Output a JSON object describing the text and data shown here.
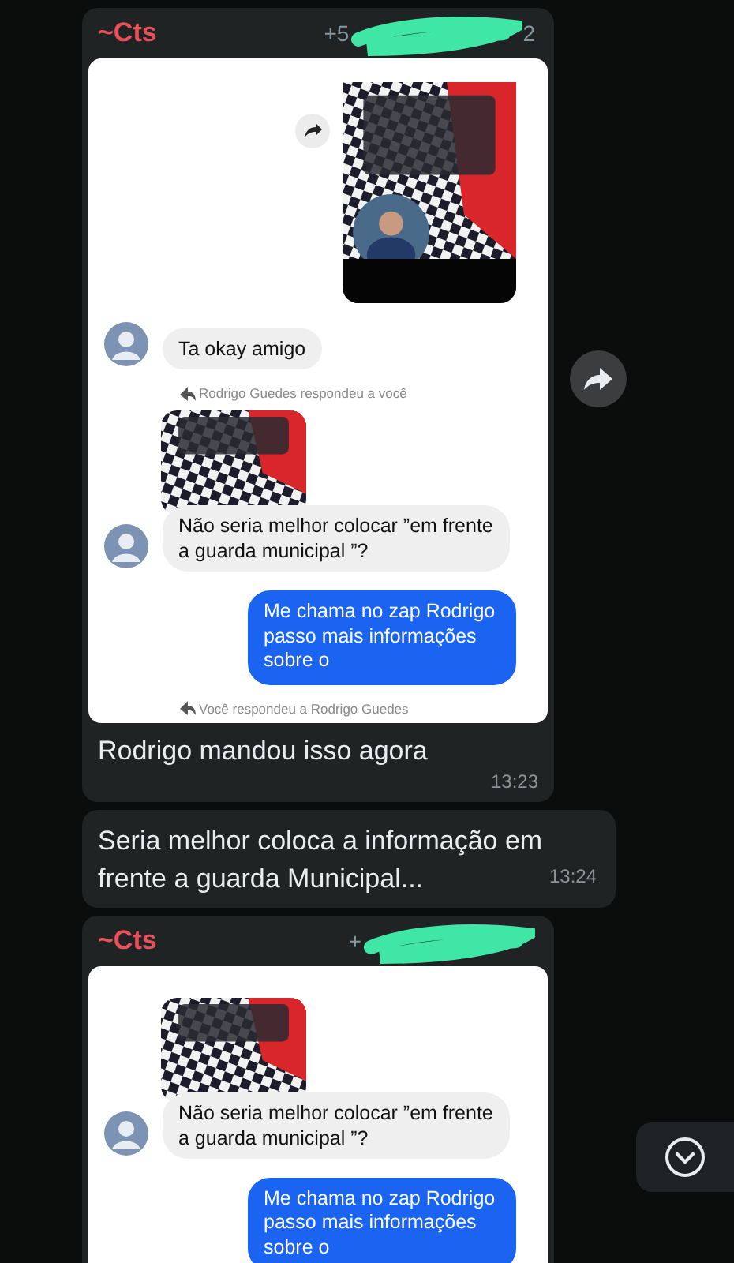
{
  "messages": [
    {
      "kind": "forwarded_screenshot",
      "sender": "~Cts",
      "phone_start": "+5",
      "phone_end": "2",
      "screenshot": {
        "items": [
          {
            "kind": "shared_post"
          },
          {
            "kind": "incoming",
            "text": "Ta okay amigo"
          },
          {
            "kind": "reply_note",
            "text": "Rodrigo Guedes respondeu a você"
          },
          {
            "kind": "reply_preview"
          },
          {
            "kind": "incoming",
            "text": "Não seria melhor colocar ”em frente a guarda municipal ”?"
          },
          {
            "kind": "outgoing",
            "text": "Me chama no zap Rodrigo passo mais informações sobre o"
          },
          {
            "kind": "reply_note",
            "text": "Você respondeu a Rodrigo Guedes"
          }
        ]
      },
      "caption": "Rodrigo mandou isso agora",
      "time": "13:23"
    },
    {
      "kind": "text",
      "text": "Seria melhor coloca a informação em frente a guarda Municipal...",
      "time": "13:24"
    },
    {
      "kind": "forwarded_screenshot",
      "sender": "~Cts",
      "phone_start": "+",
      "screenshot": {
        "items": [
          {
            "kind": "reply_preview"
          },
          {
            "kind": "incoming",
            "text": "Não seria melhor colocar ”em frente a guarda municipal ”?"
          },
          {
            "kind": "outgoing",
            "text": "Me chama no zap Rodrigo passo mais informações sobre o"
          }
        ]
      }
    }
  ]
}
